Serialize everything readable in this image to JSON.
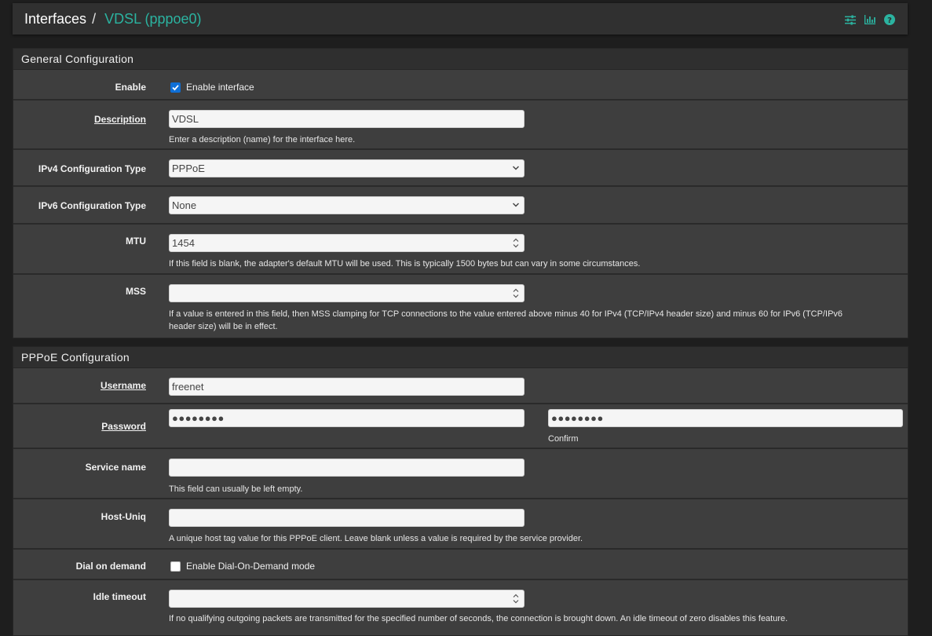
{
  "header": {
    "breadcrumb_root": "Interfaces",
    "separator": "/",
    "breadcrumb_current": "VDSL (pppoe0)",
    "icons": [
      "sliders-icon",
      "bar-chart-icon",
      "help-icon"
    ],
    "accent_color": "#2bb3a0"
  },
  "general": {
    "heading": "General Configuration",
    "enable": {
      "label": "Enable",
      "checkbox_label": "Enable interface",
      "checked": true
    },
    "description": {
      "label": "Description",
      "value": "VDSL",
      "help": "Enter a description (name) for the interface here."
    },
    "ipv4": {
      "label": "IPv4 Configuration Type",
      "value": "PPPoE"
    },
    "ipv6": {
      "label": "IPv6 Configuration Type",
      "value": "None"
    },
    "mtu": {
      "label": "MTU",
      "value": "1454",
      "help": "If this field is blank, the adapter's default MTU will be used. This is typically 1500 bytes but can vary in some circumstances."
    },
    "mss": {
      "label": "MSS",
      "value": "",
      "help_line1": "If a value is entered in this field, then MSS clamping for TCP connections to the value entered above minus 40 for IPv4 (TCP/IPv4 header size) and minus 60 for IPv6 (TCP/IPv6",
      "help_line2": "header size) will be in effect."
    }
  },
  "pppoe": {
    "heading": "PPPoE Configuration",
    "username": {
      "label": "Username",
      "value": "freenet"
    },
    "password": {
      "label": "Password",
      "value": "●●●●●●●●",
      "confirm_value": "●●●●●●●●",
      "confirm_label": "Confirm"
    },
    "service_name": {
      "label": "Service name",
      "value": "",
      "help": "This field can usually be left empty."
    },
    "host_uniq": {
      "label": "Host-Uniq",
      "value": "",
      "help": "A unique host tag value for this PPPoE client. Leave blank unless a value is required by the service provider."
    },
    "dial_on_demand": {
      "label": "Dial on demand",
      "checkbox_label": "Enable Dial-On-Demand mode",
      "checked": false
    },
    "idle_timeout": {
      "label": "Idle timeout",
      "value": "",
      "help": "If no qualifying outgoing packets are transmitted for the specified number of seconds, the connection is brought down. An idle timeout of zero disables this feature."
    }
  }
}
